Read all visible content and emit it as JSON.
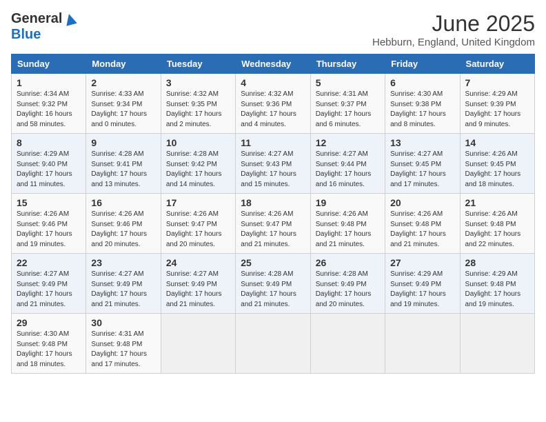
{
  "header": {
    "logo_general": "General",
    "logo_blue": "Blue",
    "month_title": "June 2025",
    "location": "Hebburn, England, United Kingdom"
  },
  "days_of_week": [
    "Sunday",
    "Monday",
    "Tuesday",
    "Wednesday",
    "Thursday",
    "Friday",
    "Saturday"
  ],
  "weeks": [
    [
      {
        "day": "1",
        "sunrise": "4:34 AM",
        "sunset": "9:32 PM",
        "daylight": "16 hours and 58 minutes."
      },
      {
        "day": "2",
        "sunrise": "4:33 AM",
        "sunset": "9:34 PM",
        "daylight": "17 hours and 0 minutes."
      },
      {
        "day": "3",
        "sunrise": "4:32 AM",
        "sunset": "9:35 PM",
        "daylight": "17 hours and 2 minutes."
      },
      {
        "day": "4",
        "sunrise": "4:32 AM",
        "sunset": "9:36 PM",
        "daylight": "17 hours and 4 minutes."
      },
      {
        "day": "5",
        "sunrise": "4:31 AM",
        "sunset": "9:37 PM",
        "daylight": "17 hours and 6 minutes."
      },
      {
        "day": "6",
        "sunrise": "4:30 AM",
        "sunset": "9:38 PM",
        "daylight": "17 hours and 8 minutes."
      },
      {
        "day": "7",
        "sunrise": "4:29 AM",
        "sunset": "9:39 PM",
        "daylight": "17 hours and 9 minutes."
      }
    ],
    [
      {
        "day": "8",
        "sunrise": "4:29 AM",
        "sunset": "9:40 PM",
        "daylight": "17 hours and 11 minutes."
      },
      {
        "day": "9",
        "sunrise": "4:28 AM",
        "sunset": "9:41 PM",
        "daylight": "17 hours and 13 minutes."
      },
      {
        "day": "10",
        "sunrise": "4:28 AM",
        "sunset": "9:42 PM",
        "daylight": "17 hours and 14 minutes."
      },
      {
        "day": "11",
        "sunrise": "4:27 AM",
        "sunset": "9:43 PM",
        "daylight": "17 hours and 15 minutes."
      },
      {
        "day": "12",
        "sunrise": "4:27 AM",
        "sunset": "9:44 PM",
        "daylight": "17 hours and 16 minutes."
      },
      {
        "day": "13",
        "sunrise": "4:27 AM",
        "sunset": "9:45 PM",
        "daylight": "17 hours and 17 minutes."
      },
      {
        "day": "14",
        "sunrise": "4:26 AM",
        "sunset": "9:45 PM",
        "daylight": "17 hours and 18 minutes."
      }
    ],
    [
      {
        "day": "15",
        "sunrise": "4:26 AM",
        "sunset": "9:46 PM",
        "daylight": "17 hours and 19 minutes."
      },
      {
        "day": "16",
        "sunrise": "4:26 AM",
        "sunset": "9:46 PM",
        "daylight": "17 hours and 20 minutes."
      },
      {
        "day": "17",
        "sunrise": "4:26 AM",
        "sunset": "9:47 PM",
        "daylight": "17 hours and 20 minutes."
      },
      {
        "day": "18",
        "sunrise": "4:26 AM",
        "sunset": "9:47 PM",
        "daylight": "17 hours and 21 minutes."
      },
      {
        "day": "19",
        "sunrise": "4:26 AM",
        "sunset": "9:48 PM",
        "daylight": "17 hours and 21 minutes."
      },
      {
        "day": "20",
        "sunrise": "4:26 AM",
        "sunset": "9:48 PM",
        "daylight": "17 hours and 21 minutes."
      },
      {
        "day": "21",
        "sunrise": "4:26 AM",
        "sunset": "9:48 PM",
        "daylight": "17 hours and 22 minutes."
      }
    ],
    [
      {
        "day": "22",
        "sunrise": "4:27 AM",
        "sunset": "9:49 PM",
        "daylight": "17 hours and 21 minutes."
      },
      {
        "day": "23",
        "sunrise": "4:27 AM",
        "sunset": "9:49 PM",
        "daylight": "17 hours and 21 minutes."
      },
      {
        "day": "24",
        "sunrise": "4:27 AM",
        "sunset": "9:49 PM",
        "daylight": "17 hours and 21 minutes."
      },
      {
        "day": "25",
        "sunrise": "4:28 AM",
        "sunset": "9:49 PM",
        "daylight": "17 hours and 21 minutes."
      },
      {
        "day": "26",
        "sunrise": "4:28 AM",
        "sunset": "9:49 PM",
        "daylight": "17 hours and 20 minutes."
      },
      {
        "day": "27",
        "sunrise": "4:29 AM",
        "sunset": "9:49 PM",
        "daylight": "17 hours and 19 minutes."
      },
      {
        "day": "28",
        "sunrise": "4:29 AM",
        "sunset": "9:48 PM",
        "daylight": "17 hours and 19 minutes."
      }
    ],
    [
      {
        "day": "29",
        "sunrise": "4:30 AM",
        "sunset": "9:48 PM",
        "daylight": "17 hours and 18 minutes."
      },
      {
        "day": "30",
        "sunrise": "4:31 AM",
        "sunset": "9:48 PM",
        "daylight": "17 hours and 17 minutes."
      },
      null,
      null,
      null,
      null,
      null
    ]
  ],
  "labels": {
    "sunrise": "Sunrise:",
    "sunset": "Sunset:",
    "daylight": "Daylight:"
  }
}
